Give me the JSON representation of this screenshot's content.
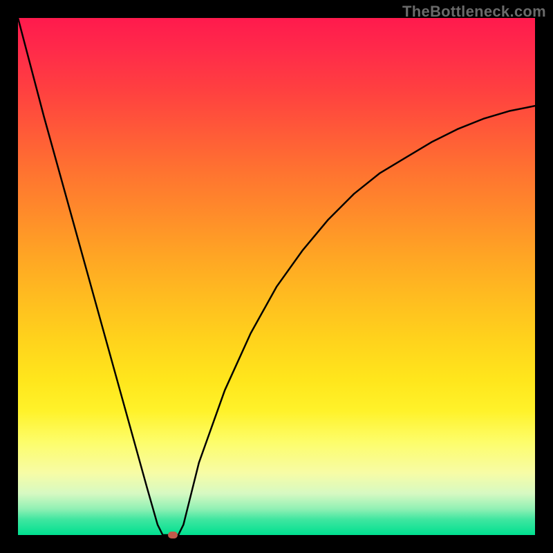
{
  "watermark": "TheBottleneck.com",
  "chart_data": {
    "type": "line",
    "title": "",
    "xlabel": "",
    "ylabel": "",
    "xlim": [
      0,
      100
    ],
    "ylim": [
      0,
      100
    ],
    "x": [
      0,
      5,
      10,
      15,
      20,
      25,
      27,
      28,
      29,
      30,
      31,
      32,
      33,
      35,
      40,
      45,
      50,
      55,
      60,
      65,
      70,
      75,
      80,
      85,
      90,
      95,
      100
    ],
    "values": [
      100,
      81,
      63,
      45,
      27,
      9,
      2,
      0,
      0,
      0,
      0,
      2,
      6,
      14,
      28,
      39,
      48,
      55,
      61,
      66,
      70,
      73,
      76,
      78.5,
      80.5,
      82,
      83
    ],
    "marker": {
      "x": 30,
      "y": 0
    },
    "colors": {
      "curve": "#000000",
      "marker": "#c15a4a"
    }
  }
}
